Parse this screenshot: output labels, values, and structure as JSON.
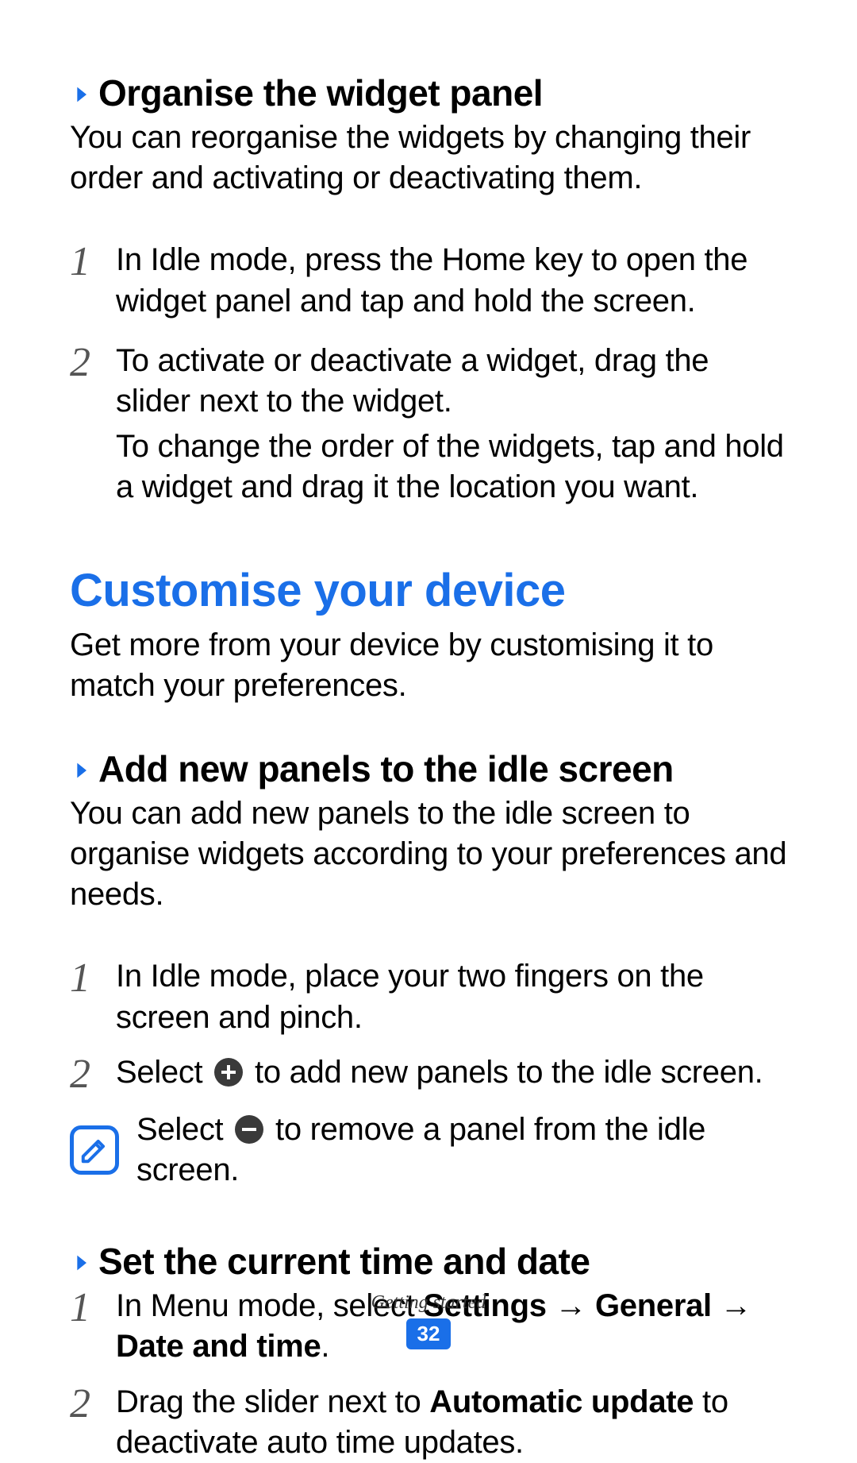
{
  "section1": {
    "heading": "Organise the widget panel",
    "intro": "You can reorganise the widgets by changing their order and activating or deactivating them.",
    "steps": [
      {
        "num": "1",
        "paras": [
          "In Idle mode, press the Home key to open the widget panel and tap and hold the screen."
        ]
      },
      {
        "num": "2",
        "paras": [
          "To activate or deactivate a widget, drag the slider next to the widget.",
          "To change the order of the widgets, tap and hold a widget and drag it the location you want."
        ]
      }
    ]
  },
  "section2": {
    "title": "Customise your device",
    "intro": "Get more from your device by customising it to match your preferences.",
    "sub1": {
      "heading": "Add new panels to the idle screen",
      "intro": "You can add new panels to the idle screen to organise widgets according to your preferences and needs.",
      "step1_num": "1",
      "step1_text": "In Idle mode, place your two fingers on the screen and pinch.",
      "step2_num": "2",
      "step2_prefix": "Select ",
      "step2_suffix": " to add new panels to the idle screen.",
      "note_prefix": "Select ",
      "note_suffix": " to remove a panel from the idle screen."
    },
    "sub2": {
      "heading": "Set the current time and date",
      "step1_num": "1",
      "step1_prefix": "In Menu mode, select ",
      "step1_bold1": "Settings",
      "step1_arrow1": " → ",
      "step1_bold2": "General",
      "step1_arrow2": " → ",
      "step1_bold3": "Date and time",
      "step1_period": ".",
      "step2_num": "2",
      "step2_prefix": "Drag the slider next to ",
      "step2_bold": "Automatic update",
      "step2_suffix": " to deactivate auto time updates."
    }
  },
  "footer": {
    "label": "Getting started",
    "page": "32"
  }
}
